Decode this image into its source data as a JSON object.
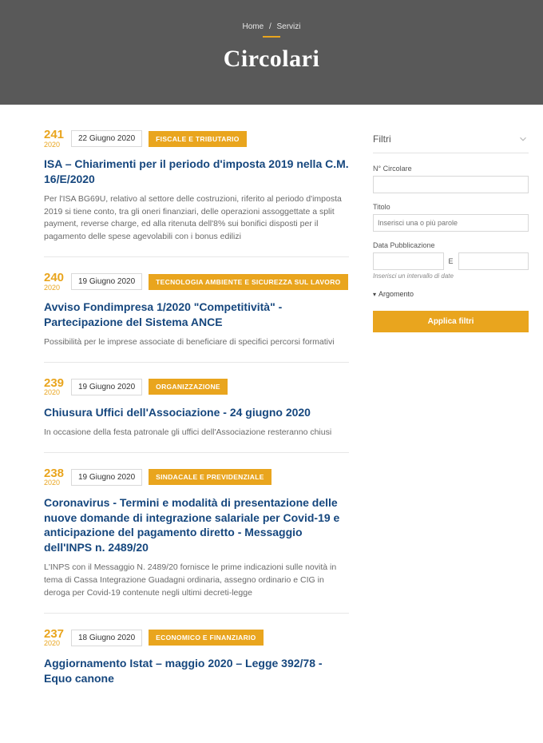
{
  "breadcrumb": {
    "home": "Home",
    "sep": "/",
    "current": "Servizi"
  },
  "hero": {
    "title": "Circolari"
  },
  "items": [
    {
      "number": "241",
      "year": "2020",
      "date": "22 Giugno 2020",
      "tag": "FISCALE E TRIBUTARIO",
      "title": "ISA – Chiarimenti per il periodo d'imposta 2019 nella C.M. 16/E/2020",
      "body": "Per l'ISA BG69U, relativo al settore delle costruzioni, riferito al periodo d'imposta 2019 si tiene conto, tra gli oneri finanziari, delle operazioni assoggettate a split payment, reverse charge, ed alla ritenuta dell'8% sui bonifici disposti per il pagamento delle spese agevolabili con i bonus edilizi"
    },
    {
      "number": "240",
      "year": "2020",
      "date": "19 Giugno 2020",
      "tag": "TECNOLOGIA AMBIENTE E SICUREZZA SUL LAVORO",
      "title": "Avviso Fondimpresa 1/2020 \"Competitività\" - Partecipazione del Sistema ANCE",
      "body": "Possibilità per le imprese associate di beneficiare di specifici percorsi formativi"
    },
    {
      "number": "239",
      "year": "2020",
      "date": "19 Giugno 2020",
      "tag": "ORGANIZZAZIONE",
      "title": "Chiusura Uffici dell'Associazione - 24 giugno 2020",
      "body": "In occasione della festa patronale gli uffici dell'Associazione resteranno chiusi"
    },
    {
      "number": "238",
      "year": "2020",
      "date": "19 Giugno 2020",
      "tag": "SINDACALE E PREVIDENZIALE",
      "title": "Coronavirus - Termini e modalità di presentazione delle nuove domande di integrazione salariale per Covid-19 e anticipazione del pagamento diretto - Messaggio dell'INPS n. 2489/20",
      "body": "L'INPS con il Messaggio N. 2489/20 fornisce le prime indicazioni sulle novità in tema di Cassa Integrazione Guadagni ordinaria, assegno ordinario e CIG in deroga per Covid-19 contenute negli ultimi decreti-legge"
    },
    {
      "number": "237",
      "year": "2020",
      "date": "18 Giugno 2020",
      "tag": "ECONOMICO E FINANZIARIO",
      "title": "Aggiornamento Istat – maggio 2020 – Legge 392/78 - Equo canone",
      "body": ""
    }
  ],
  "filters": {
    "heading": "Filtri",
    "numLabel": "N° Circolare",
    "titleLabel": "Titolo",
    "titlePlaceholder": "Inserisci una o più parole",
    "dateLabel": "Data Pubblicazione",
    "dateSep": "E",
    "dateHint": "Inserisci un intervallo di date",
    "argomento": "Argomento",
    "applyLabel": "Applica filtri"
  }
}
